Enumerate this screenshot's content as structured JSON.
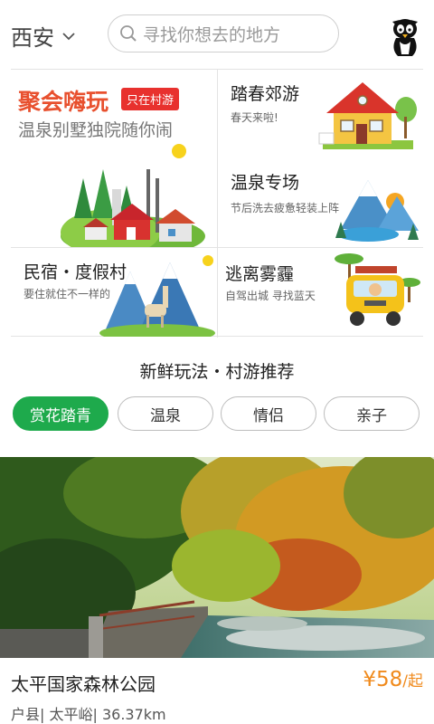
{
  "header": {
    "city": "西安",
    "search_placeholder": "寻找你想去的地方"
  },
  "promos": {
    "main": {
      "title": "聚会嗨玩",
      "tag": "只在村游",
      "subtitle": "温泉别墅独院随你闹"
    },
    "spring": {
      "title": "踏春郊游",
      "subtitle": "春天来啦!"
    },
    "hotspring": {
      "title": "温泉专场",
      "subtitle": "节后洗去疲惫轻装上阵"
    },
    "homestay": {
      "title": "民宿・度假村",
      "subtitle": "要住就住不一样的"
    },
    "smog": {
      "title": "逃离雾霾",
      "subtitle": "自驾出城  寻找蓝天"
    }
  },
  "section": {
    "title": "新鲜玩法・村游推荐"
  },
  "filters": [
    {
      "label": "赏花踏青",
      "active": true
    },
    {
      "label": "温泉",
      "active": false
    },
    {
      "label": "情侣",
      "active": false
    },
    {
      "label": "亲子",
      "active": false
    }
  ],
  "listing": {
    "name": "太平国家森林公园",
    "price": "¥58",
    "price_unit": "/起",
    "meta": "户县| 太平峪| 36.37km"
  },
  "colors": {
    "accent_green": "#1eaa4c",
    "price_orange": "#f08a1c",
    "tag_red": "#e8312e"
  },
  "icons": [
    "chevron-down-icon",
    "search-icon",
    "penguin-avatar-icon"
  ]
}
